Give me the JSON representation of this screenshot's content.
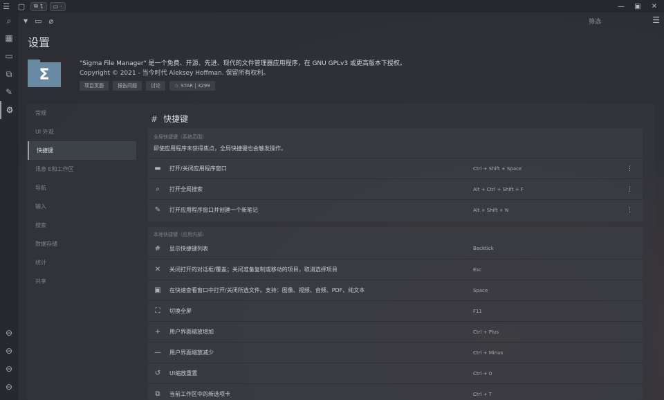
{
  "topbar": {
    "tab_count": "1"
  },
  "toolbar": {
    "filter_label": "筛选"
  },
  "page": {
    "title": "设置"
  },
  "about": {
    "description": "\"Sigma File Manager\" 是一个免费、开源、先进、现代的文件管理器应用程序，在 GNU GPLv3 或更高版本下授权。",
    "copyright": "Copyright © 2021 - 当今时代 Aleksey Hoffman. 保留所有权利。",
    "links": [
      "项目页面",
      "报告问题",
      "讨论",
      "STAR | 3299"
    ],
    "logo_letter": "Σ"
  },
  "nav": {
    "items": [
      "常规",
      "UI 外观",
      "快捷键",
      "讯息 E和工作区",
      "导航",
      "输入",
      "搜索",
      "数据存储",
      "统计",
      "共享"
    ],
    "active_index": 2
  },
  "section": {
    "title": "快捷键"
  },
  "global_group": {
    "label": "全局快捷键（系统范围）",
    "description": "即使应用程序未获得焦点，全局快捷键也会触发操作。",
    "rows": [
      {
        "icon": "window-icon",
        "label": "打开/关闭应用程序窗口",
        "key": "Ctrl + Shift + Space"
      },
      {
        "icon": "search-icon",
        "label": "打开全局搜索",
        "key": "Alt + Ctrl + Shift + F"
      },
      {
        "icon": "note-edit-icon",
        "label": "打开应用程序窗口并创建一个新笔记",
        "key": "Alt + Shift + N"
      }
    ]
  },
  "local_group": {
    "label": "本地快捷键（应用内部）",
    "rows": [
      {
        "icon": "hash-icon",
        "label": "显示快捷键列表",
        "key": "Backtick"
      },
      {
        "icon": "close-icon",
        "label": "关闭打开的对话框/覆盖；关闭准备复制或移动的项目，取消选择项目",
        "key": "Esc"
      },
      {
        "icon": "quick-view-icon",
        "label": "在快速查看窗口中打开/关闭所选文件。支持：图像、视频、音频、PDF、纯文本",
        "key": "Space"
      },
      {
        "icon": "fullscreen-icon",
        "label": "切换全屏",
        "key": "F11"
      },
      {
        "icon": "plus-icon",
        "label": "用户界面缩放增加",
        "key": "Ctrl + Plus"
      },
      {
        "icon": "minus-icon",
        "label": "用户界面缩放减少",
        "key": "Ctrl + Minus"
      },
      {
        "icon": "reset-icon",
        "label": "UI缩放重置",
        "key": "Ctrl + 0"
      },
      {
        "icon": "new-tab-icon",
        "label": "当前工作区中的新选项卡",
        "key": "Ctrl + T"
      }
    ]
  }
}
